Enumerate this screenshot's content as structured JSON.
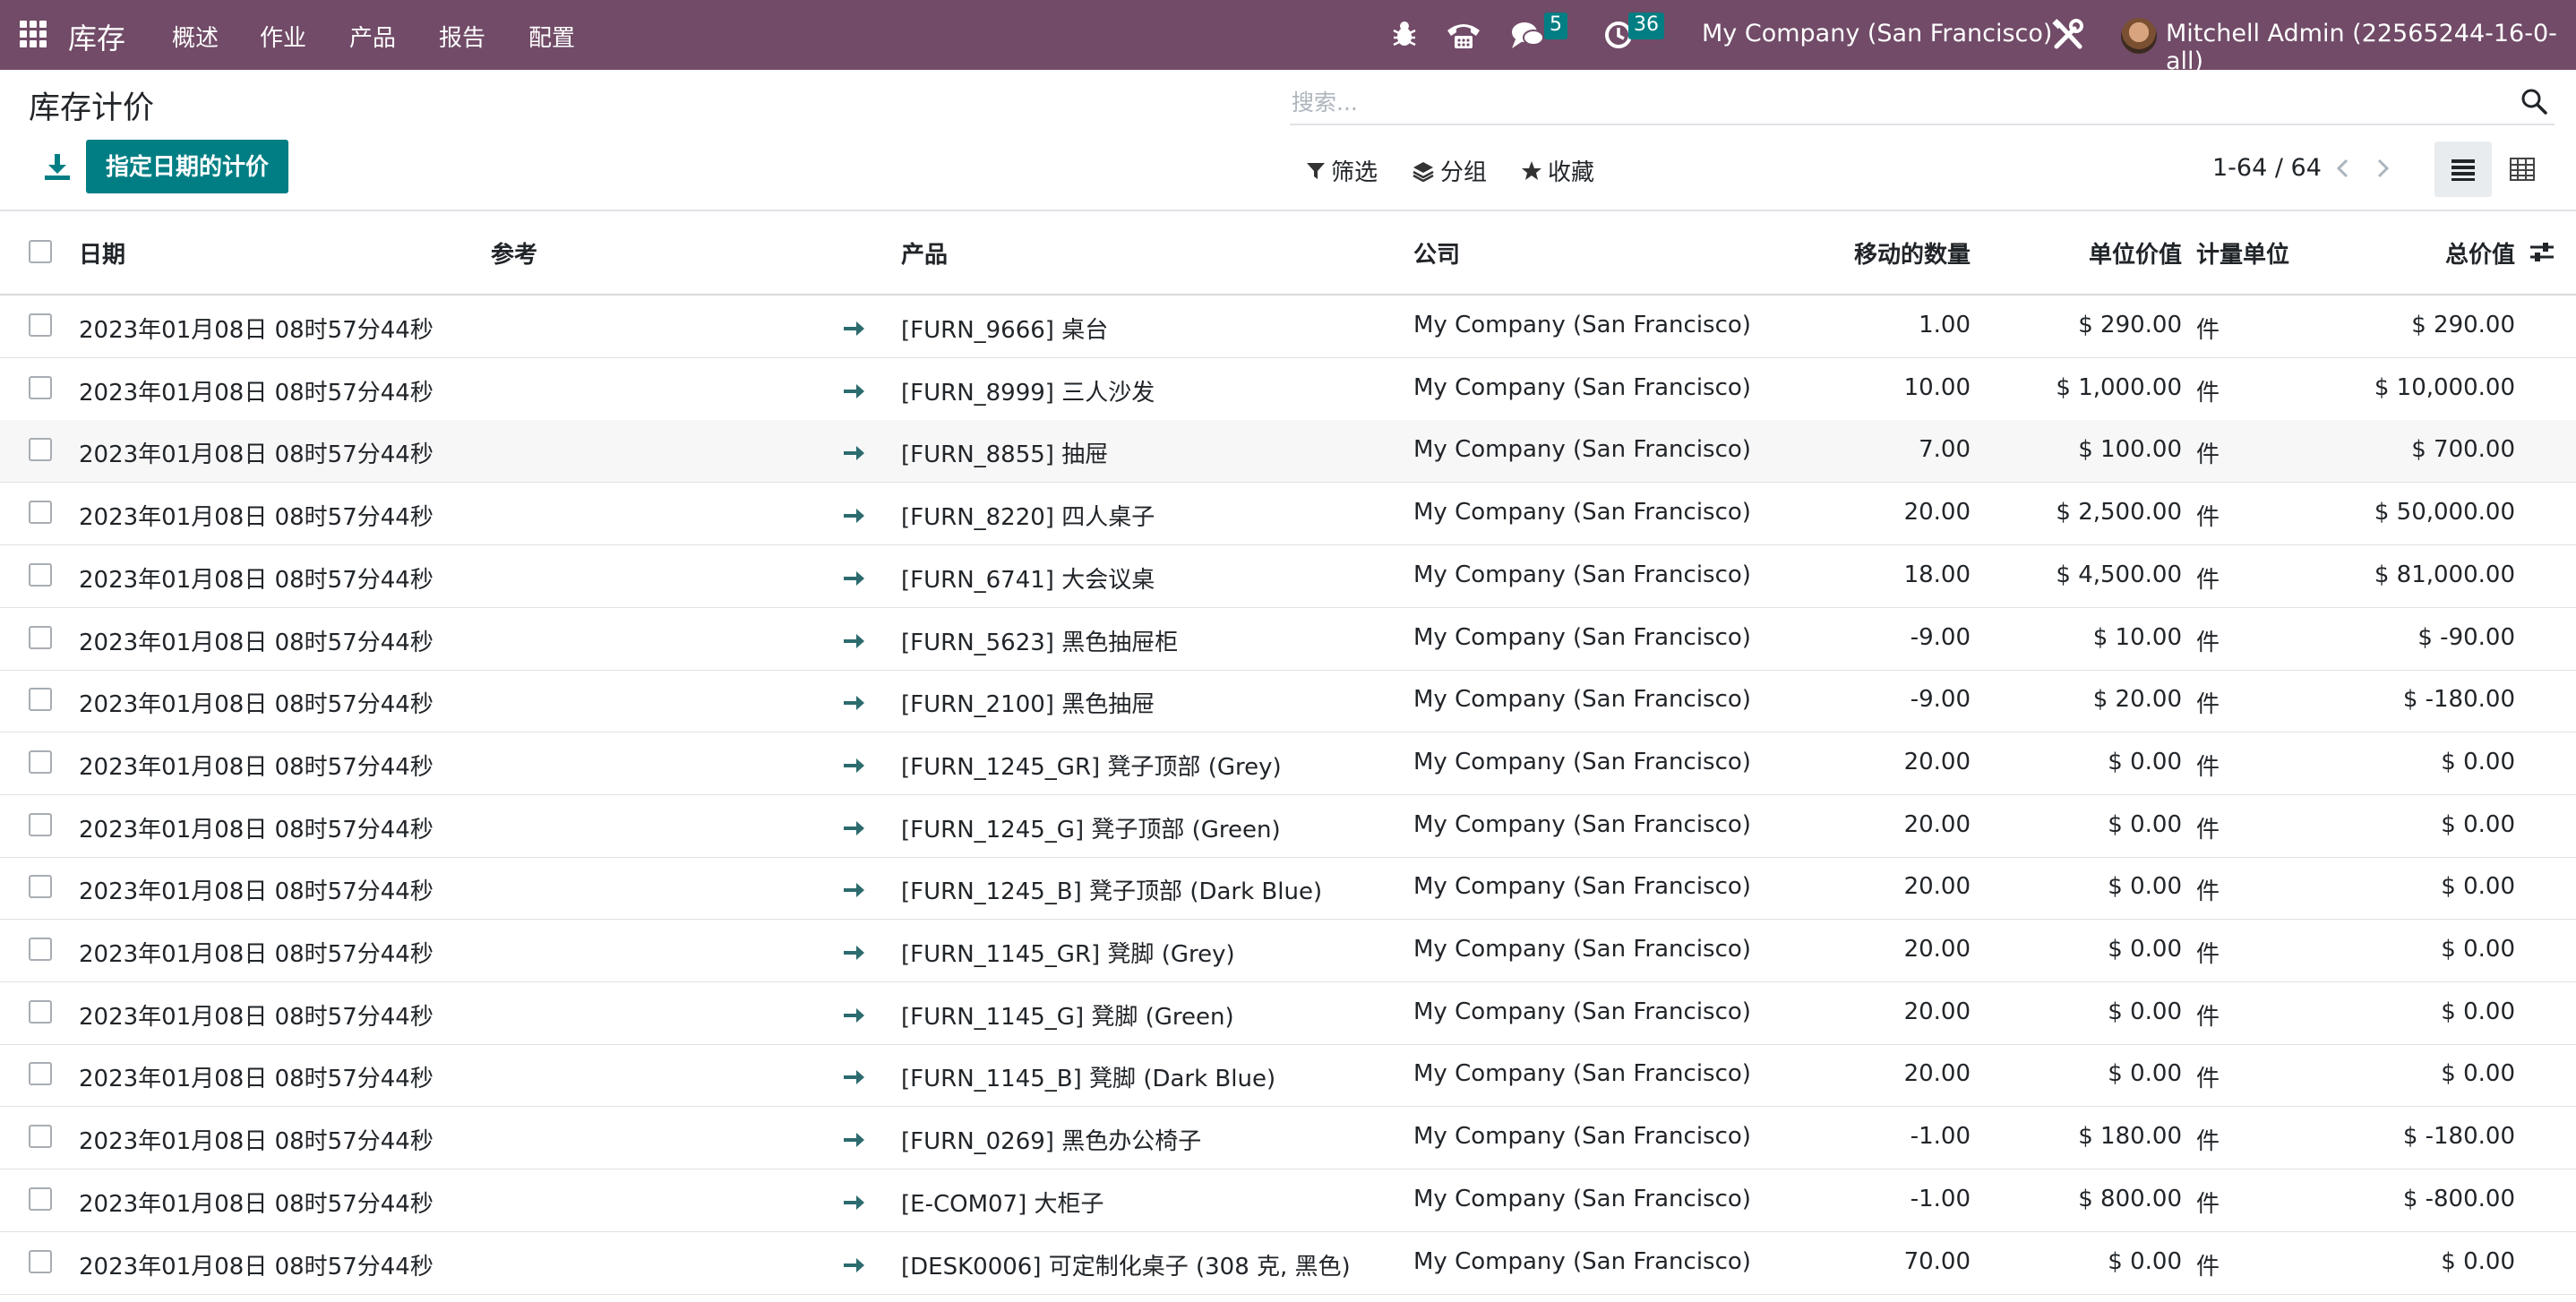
{
  "navbar": {
    "app_name": "库存",
    "menu": [
      "概述",
      "作业",
      "产品",
      "报告",
      "配置"
    ],
    "messages_count": "5",
    "activities_count": "36",
    "company": "My Company (San Francisco)",
    "user": "Mitchell Admin (22565244-16-0-all)"
  },
  "page": {
    "title": "库存计价",
    "primary_button": "指定日期的计价",
    "search_placeholder": "搜索...",
    "filters_label": "筛选",
    "groupby_label": "分组",
    "favorites_label": "收藏",
    "pager": "1-64 / 64"
  },
  "table": {
    "headers": {
      "date": "日期",
      "reference": "参考",
      "product": "产品",
      "company": "公司",
      "quantity": "移动的数量",
      "unit_value": "单位价值",
      "uom": "计量单位",
      "total_value": "总价值"
    },
    "rows": [
      {
        "date": "2023年01月08日 08时57分44秒",
        "product": "[FURN_9666] 桌台",
        "company": "My Company (San Francisco)",
        "quantity": "1.00",
        "unit_value": "$ 290.00",
        "uom": "件",
        "total_value": "$ 290.00"
      },
      {
        "date": "2023年01月08日 08时57分44秒",
        "product": "[FURN_8999] 三人沙发",
        "company": "My Company (San Francisco)",
        "quantity": "10.00",
        "unit_value": "$ 1,000.00",
        "uom": "件",
        "total_value": "$ 10,000.00"
      },
      {
        "date": "2023年01月08日 08时57分44秒",
        "product": "[FURN_8855] 抽屉",
        "company": "My Company (San Francisco)",
        "quantity": "7.00",
        "unit_value": "$ 100.00",
        "uom": "件",
        "total_value": "$ 700.00"
      },
      {
        "date": "2023年01月08日 08时57分44秒",
        "product": "[FURN_8220] 四人桌子",
        "company": "My Company (San Francisco)",
        "quantity": "20.00",
        "unit_value": "$ 2,500.00",
        "uom": "件",
        "total_value": "$ 50,000.00"
      },
      {
        "date": "2023年01月08日 08时57分44秒",
        "product": "[FURN_6741] 大会议桌",
        "company": "My Company (San Francisco)",
        "quantity": "18.00",
        "unit_value": "$ 4,500.00",
        "uom": "件",
        "total_value": "$ 81,000.00"
      },
      {
        "date": "2023年01月08日 08时57分44秒",
        "product": "[FURN_5623] 黑色抽屉柜",
        "company": "My Company (San Francisco)",
        "quantity": "-9.00",
        "unit_value": "$ 10.00",
        "uom": "件",
        "total_value": "$ -90.00"
      },
      {
        "date": "2023年01月08日 08时57分44秒",
        "product": "[FURN_2100] 黑色抽屉",
        "company": "My Company (San Francisco)",
        "quantity": "-9.00",
        "unit_value": "$ 20.00",
        "uom": "件",
        "total_value": "$ -180.00"
      },
      {
        "date": "2023年01月08日 08时57分44秒",
        "product": "[FURN_1245_GR] 凳子顶部 (Grey)",
        "company": "My Company (San Francisco)",
        "quantity": "20.00",
        "unit_value": "$ 0.00",
        "uom": "件",
        "total_value": "$ 0.00"
      },
      {
        "date": "2023年01月08日 08时57分44秒",
        "product": "[FURN_1245_G] 凳子顶部 (Green)",
        "company": "My Company (San Francisco)",
        "quantity": "20.00",
        "unit_value": "$ 0.00",
        "uom": "件",
        "total_value": "$ 0.00"
      },
      {
        "date": "2023年01月08日 08时57分44秒",
        "product": "[FURN_1245_B] 凳子顶部 (Dark Blue)",
        "company": "My Company (San Francisco)",
        "quantity": "20.00",
        "unit_value": "$ 0.00",
        "uom": "件",
        "total_value": "$ 0.00"
      },
      {
        "date": "2023年01月08日 08时57分44秒",
        "product": "[FURN_1145_GR] 凳脚 (Grey)",
        "company": "My Company (San Francisco)",
        "quantity": "20.00",
        "unit_value": "$ 0.00",
        "uom": "件",
        "total_value": "$ 0.00"
      },
      {
        "date": "2023年01月08日 08时57分44秒",
        "product": "[FURN_1145_G] 凳脚 (Green)",
        "company": "My Company (San Francisco)",
        "quantity": "20.00",
        "unit_value": "$ 0.00",
        "uom": "件",
        "total_value": "$ 0.00"
      },
      {
        "date": "2023年01月08日 08时57分44秒",
        "product": "[FURN_1145_B] 凳脚 (Dark Blue)",
        "company": "My Company (San Francisco)",
        "quantity": "20.00",
        "unit_value": "$ 0.00",
        "uom": "件",
        "total_value": "$ 0.00"
      },
      {
        "date": "2023年01月08日 08时57分44秒",
        "product": "[FURN_0269] 黑色办公椅子",
        "company": "My Company (San Francisco)",
        "quantity": "-1.00",
        "unit_value": "$ 180.00",
        "uom": "件",
        "total_value": "$ -180.00"
      },
      {
        "date": "2023年01月08日 08时57分44秒",
        "product": "[E-COM07] 大柜子",
        "company": "My Company (San Francisco)",
        "quantity": "-1.00",
        "unit_value": "$ 800.00",
        "uom": "件",
        "total_value": "$ -800.00"
      },
      {
        "date": "2023年01月08日 08时57分44秒",
        "product": "[DESK0006] 可定制化桌子 (308 克, 黑色)",
        "company": "My Company (San Francisco)",
        "quantity": "70.00",
        "unit_value": "$ 0.00",
        "uom": "件",
        "total_value": "$ 0.00"
      }
    ]
  },
  "colors": {
    "navbar": "#714b67",
    "primary": "#017e84",
    "row_arrow": "#2c6b6e"
  },
  "icons": {
    "apps": "apps-grid-icon",
    "debug": "bug-icon",
    "phone": "phone-icon",
    "messages": "chat-icon",
    "activities": "clock-icon",
    "settings": "tools-icon",
    "search": "search-icon",
    "download": "download-icon",
    "list_view": "list-view-icon",
    "pivot_view": "pivot-view-icon"
  }
}
